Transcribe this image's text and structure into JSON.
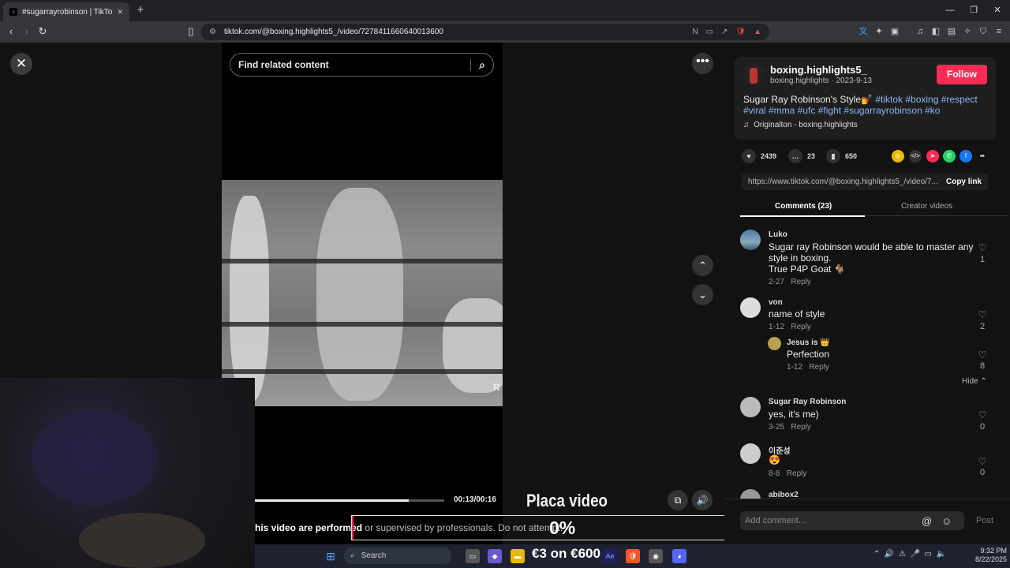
{
  "browser": {
    "tab_title": "#sugarrayrobinson | TikTok",
    "url": "tiktok.com/@boxing.highlights5_/video/7278411660640013600",
    "new_tab": "+",
    "minimize": "—",
    "maximize": "❐",
    "close": "✕"
  },
  "search": {
    "placeholder": "Find related content"
  },
  "video": {
    "time": "00:13/00:16",
    "progress": 0.8125,
    "watermark": "R"
  },
  "author": {
    "username": "boxing.highlights5_",
    "subline": "boxing.highlights · 2023-9-13",
    "follow_label": "Follow"
  },
  "caption": {
    "text": "Sugar Ray Robinson's Style💅",
    "tags_line1": "#tiktok #boxing #respect",
    "tags_line2": "#viral #mma #ufc #fight #sugarrayrobinson #ko"
  },
  "music": "Originalton - boxing.highlights",
  "stats": {
    "likes": "2439",
    "comments": "23",
    "saves": "650"
  },
  "link": {
    "url": "https://www.tiktok.com/@boxing.highlights5_/video/7...",
    "copy_label": "Copy link"
  },
  "tabs": {
    "comments": "Comments (23)",
    "creator": "Creator videos"
  },
  "comments": [
    {
      "name": "Luko",
      "text1": "Sugar ray Robinson would be able to master any",
      "text2": "style in boxing.",
      "text3": "True P4P Goat 🐐",
      "date": "2-27",
      "reply": "Reply",
      "likes": "1"
    },
    {
      "name": "von",
      "text1": "name of style",
      "date": "1-12",
      "reply": "Reply",
      "likes": "2"
    },
    {
      "name": "Jesus is 👑",
      "text1": "Perfection",
      "date": "1-12",
      "reply": "Reply",
      "likes": "8"
    },
    {
      "name": "Sugar Ray Robinson",
      "text1": "yes, it's me)",
      "date": "3-25",
      "reply": "Reply",
      "likes": "0"
    },
    {
      "name": "이준성",
      "text1": "😍",
      "date": "8-8",
      "reply": "Reply",
      "likes": "0"
    },
    {
      "name": "abibox2"
    }
  ],
  "hide_label": "Hide",
  "add_comment": "Add comment...",
  "post_label": "Post",
  "overlay": {
    "label": "Placa video",
    "disclaimer_a": "his video are performed ",
    "disclaimer_b": "or supervised by professionals. Do not attempt.",
    "percent": "0%",
    "promo": "€3 on €600"
  },
  "taskbar": {
    "search": "Search",
    "time": "9:32 PM",
    "date": "8/22/2025"
  },
  "colors": {
    "accent": "#fe2c55",
    "hashtag": "#8ab4f8"
  }
}
